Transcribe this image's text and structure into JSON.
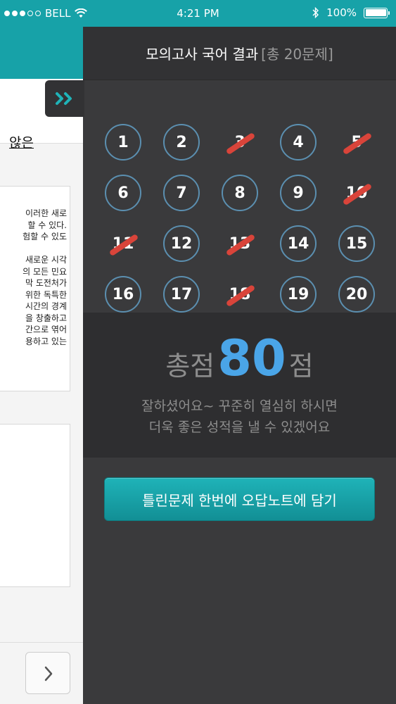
{
  "status_bar": {
    "carrier": "BELL",
    "time": "4:21 PM",
    "battery": "100%"
  },
  "background": {
    "question_tail": "않은",
    "passage_lines": [
      "이러한 새로",
      "할 수 있다.",
      "험할 수 있도",
      "",
      "새로운 시각",
      "의 모든 민요",
      "막 도전처가",
      "위한 독특한",
      "시간의 경계",
      "을 창출하고",
      "간으로 엮어",
      "용하고 있는"
    ]
  },
  "drawer": {
    "title": "모의고사 국어 결과",
    "subtitle": "[총 20문제]",
    "questions": [
      {
        "number": "1",
        "wrong": false
      },
      {
        "number": "2",
        "wrong": false
      },
      {
        "number": "3",
        "wrong": true
      },
      {
        "number": "4",
        "wrong": false
      },
      {
        "number": "5",
        "wrong": true
      },
      {
        "number": "6",
        "wrong": false
      },
      {
        "number": "7",
        "wrong": false
      },
      {
        "number": "8",
        "wrong": false
      },
      {
        "number": "9",
        "wrong": false
      },
      {
        "number": "10",
        "wrong": true
      },
      {
        "number": "11",
        "wrong": true
      },
      {
        "number": "12",
        "wrong": false
      },
      {
        "number": "13",
        "wrong": true
      },
      {
        "number": "14",
        "wrong": false
      },
      {
        "number": "15",
        "wrong": false
      },
      {
        "number": "16",
        "wrong": false
      },
      {
        "number": "17",
        "wrong": false
      },
      {
        "number": "18",
        "wrong": true
      },
      {
        "number": "19",
        "wrong": false
      },
      {
        "number": "20",
        "wrong": false
      }
    ],
    "score": {
      "prefix": "총점",
      "value": "80",
      "suffix": "점",
      "message_line1": "잘하셨어요~ 꾸준히 열심히 하시면",
      "message_line2": "더욱 좋은 성적을 낼 수 있겠어요"
    },
    "save_button": "틀린문제 한번에 오답노트에 담기"
  },
  "colors": {
    "accent": "#17a2a8",
    "score": "#4aa5e8",
    "wrong_mark": "#d9443a",
    "circle": "#5b8fb0"
  }
}
